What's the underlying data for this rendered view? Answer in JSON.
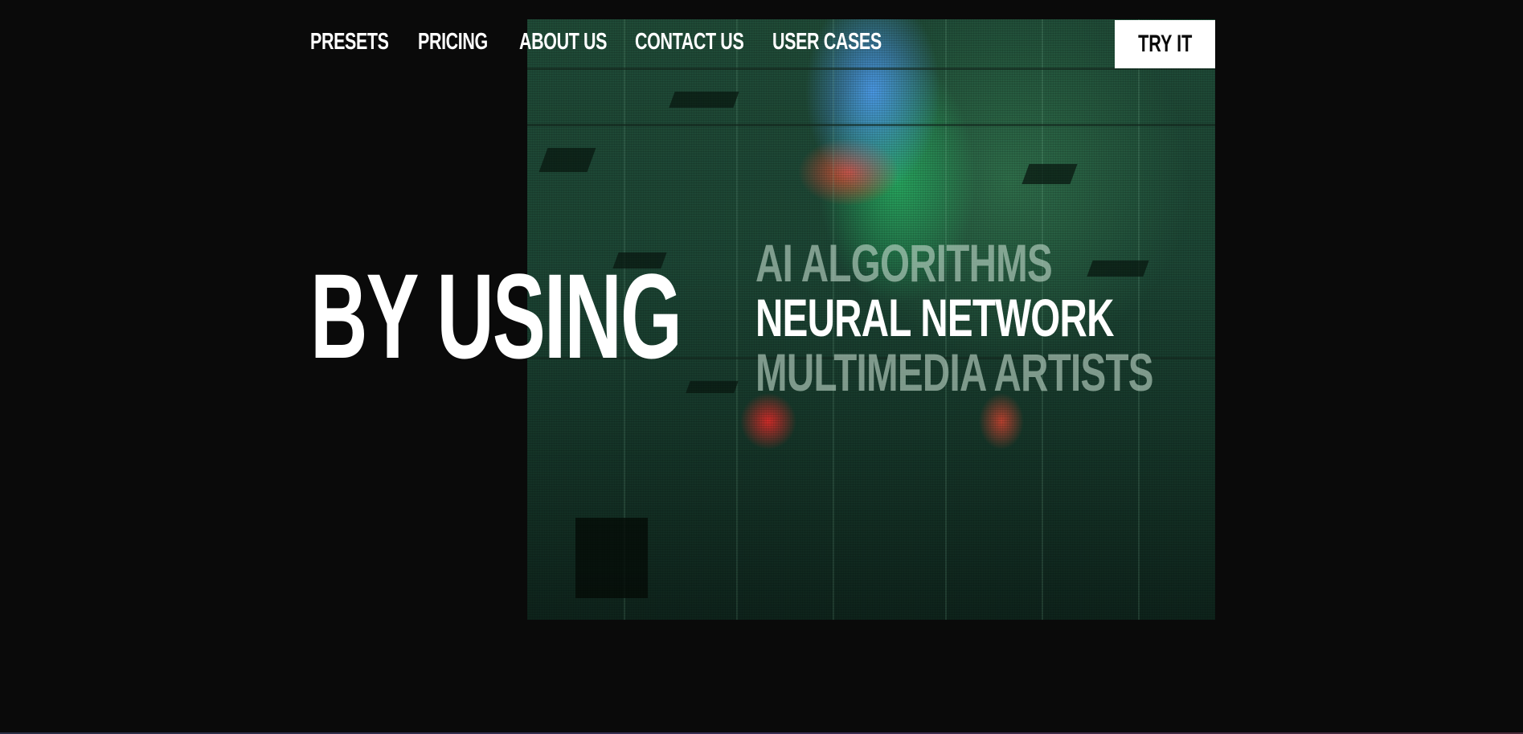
{
  "nav": {
    "items": [
      {
        "label": "PRESETS"
      },
      {
        "label": "PRICING"
      },
      {
        "label": "ABOUT US"
      },
      {
        "label": "CONTACT US"
      },
      {
        "label": "USER CASES"
      }
    ]
  },
  "cta": {
    "label": "TRY IT"
  },
  "hero": {
    "headline": "BY USING",
    "words": [
      {
        "label": "AI ALGORITHMS",
        "state": "dim"
      },
      {
        "label": "NEURAL NETWORK",
        "state": "active"
      },
      {
        "label": "MULTIMEDIA ARTISTS",
        "state": "dim"
      }
    ]
  },
  "colors": {
    "background": "#0a0a0a",
    "text": "#ffffff",
    "dim_text": "#bed7c8",
    "image_tint": "#1f4a36"
  }
}
